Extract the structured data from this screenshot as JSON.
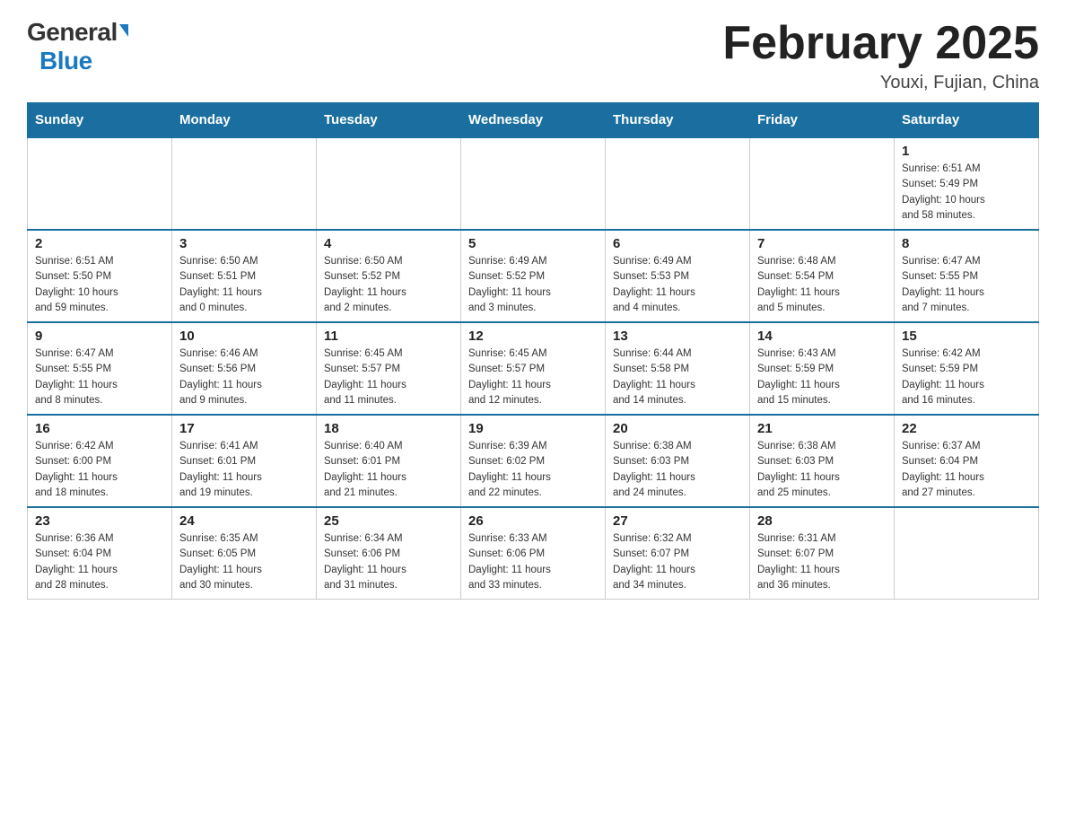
{
  "header": {
    "logo_general": "General",
    "logo_blue": "Blue",
    "title": "February 2025",
    "location": "Youxi, Fujian, China"
  },
  "days_of_week": [
    "Sunday",
    "Monday",
    "Tuesday",
    "Wednesday",
    "Thursday",
    "Friday",
    "Saturday"
  ],
  "weeks": [
    {
      "days": [
        {
          "num": "",
          "info": "",
          "empty": true
        },
        {
          "num": "",
          "info": "",
          "empty": true
        },
        {
          "num": "",
          "info": "",
          "empty": true
        },
        {
          "num": "",
          "info": "",
          "empty": true
        },
        {
          "num": "",
          "info": "",
          "empty": true
        },
        {
          "num": "",
          "info": "",
          "empty": true
        },
        {
          "num": "1",
          "info": "Sunrise: 6:51 AM\nSunset: 5:49 PM\nDaylight: 10 hours\nand 58 minutes.",
          "empty": false
        }
      ]
    },
    {
      "days": [
        {
          "num": "2",
          "info": "Sunrise: 6:51 AM\nSunset: 5:50 PM\nDaylight: 10 hours\nand 59 minutes.",
          "empty": false
        },
        {
          "num": "3",
          "info": "Sunrise: 6:50 AM\nSunset: 5:51 PM\nDaylight: 11 hours\nand 0 minutes.",
          "empty": false
        },
        {
          "num": "4",
          "info": "Sunrise: 6:50 AM\nSunset: 5:52 PM\nDaylight: 11 hours\nand 2 minutes.",
          "empty": false
        },
        {
          "num": "5",
          "info": "Sunrise: 6:49 AM\nSunset: 5:52 PM\nDaylight: 11 hours\nand 3 minutes.",
          "empty": false
        },
        {
          "num": "6",
          "info": "Sunrise: 6:49 AM\nSunset: 5:53 PM\nDaylight: 11 hours\nand 4 minutes.",
          "empty": false
        },
        {
          "num": "7",
          "info": "Sunrise: 6:48 AM\nSunset: 5:54 PM\nDaylight: 11 hours\nand 5 minutes.",
          "empty": false
        },
        {
          "num": "8",
          "info": "Sunrise: 6:47 AM\nSunset: 5:55 PM\nDaylight: 11 hours\nand 7 minutes.",
          "empty": false
        }
      ]
    },
    {
      "days": [
        {
          "num": "9",
          "info": "Sunrise: 6:47 AM\nSunset: 5:55 PM\nDaylight: 11 hours\nand 8 minutes.",
          "empty": false
        },
        {
          "num": "10",
          "info": "Sunrise: 6:46 AM\nSunset: 5:56 PM\nDaylight: 11 hours\nand 9 minutes.",
          "empty": false
        },
        {
          "num": "11",
          "info": "Sunrise: 6:45 AM\nSunset: 5:57 PM\nDaylight: 11 hours\nand 11 minutes.",
          "empty": false
        },
        {
          "num": "12",
          "info": "Sunrise: 6:45 AM\nSunset: 5:57 PM\nDaylight: 11 hours\nand 12 minutes.",
          "empty": false
        },
        {
          "num": "13",
          "info": "Sunrise: 6:44 AM\nSunset: 5:58 PM\nDaylight: 11 hours\nand 14 minutes.",
          "empty": false
        },
        {
          "num": "14",
          "info": "Sunrise: 6:43 AM\nSunset: 5:59 PM\nDaylight: 11 hours\nand 15 minutes.",
          "empty": false
        },
        {
          "num": "15",
          "info": "Sunrise: 6:42 AM\nSunset: 5:59 PM\nDaylight: 11 hours\nand 16 minutes.",
          "empty": false
        }
      ]
    },
    {
      "days": [
        {
          "num": "16",
          "info": "Sunrise: 6:42 AM\nSunset: 6:00 PM\nDaylight: 11 hours\nand 18 minutes.",
          "empty": false
        },
        {
          "num": "17",
          "info": "Sunrise: 6:41 AM\nSunset: 6:01 PM\nDaylight: 11 hours\nand 19 minutes.",
          "empty": false
        },
        {
          "num": "18",
          "info": "Sunrise: 6:40 AM\nSunset: 6:01 PM\nDaylight: 11 hours\nand 21 minutes.",
          "empty": false
        },
        {
          "num": "19",
          "info": "Sunrise: 6:39 AM\nSunset: 6:02 PM\nDaylight: 11 hours\nand 22 minutes.",
          "empty": false
        },
        {
          "num": "20",
          "info": "Sunrise: 6:38 AM\nSunset: 6:03 PM\nDaylight: 11 hours\nand 24 minutes.",
          "empty": false
        },
        {
          "num": "21",
          "info": "Sunrise: 6:38 AM\nSunset: 6:03 PM\nDaylight: 11 hours\nand 25 minutes.",
          "empty": false
        },
        {
          "num": "22",
          "info": "Sunrise: 6:37 AM\nSunset: 6:04 PM\nDaylight: 11 hours\nand 27 minutes.",
          "empty": false
        }
      ]
    },
    {
      "days": [
        {
          "num": "23",
          "info": "Sunrise: 6:36 AM\nSunset: 6:04 PM\nDaylight: 11 hours\nand 28 minutes.",
          "empty": false
        },
        {
          "num": "24",
          "info": "Sunrise: 6:35 AM\nSunset: 6:05 PM\nDaylight: 11 hours\nand 30 minutes.",
          "empty": false
        },
        {
          "num": "25",
          "info": "Sunrise: 6:34 AM\nSunset: 6:06 PM\nDaylight: 11 hours\nand 31 minutes.",
          "empty": false
        },
        {
          "num": "26",
          "info": "Sunrise: 6:33 AM\nSunset: 6:06 PM\nDaylight: 11 hours\nand 33 minutes.",
          "empty": false
        },
        {
          "num": "27",
          "info": "Sunrise: 6:32 AM\nSunset: 6:07 PM\nDaylight: 11 hours\nand 34 minutes.",
          "empty": false
        },
        {
          "num": "28",
          "info": "Sunrise: 6:31 AM\nSunset: 6:07 PM\nDaylight: 11 hours\nand 36 minutes.",
          "empty": false
        },
        {
          "num": "",
          "info": "",
          "empty": true
        }
      ]
    }
  ]
}
